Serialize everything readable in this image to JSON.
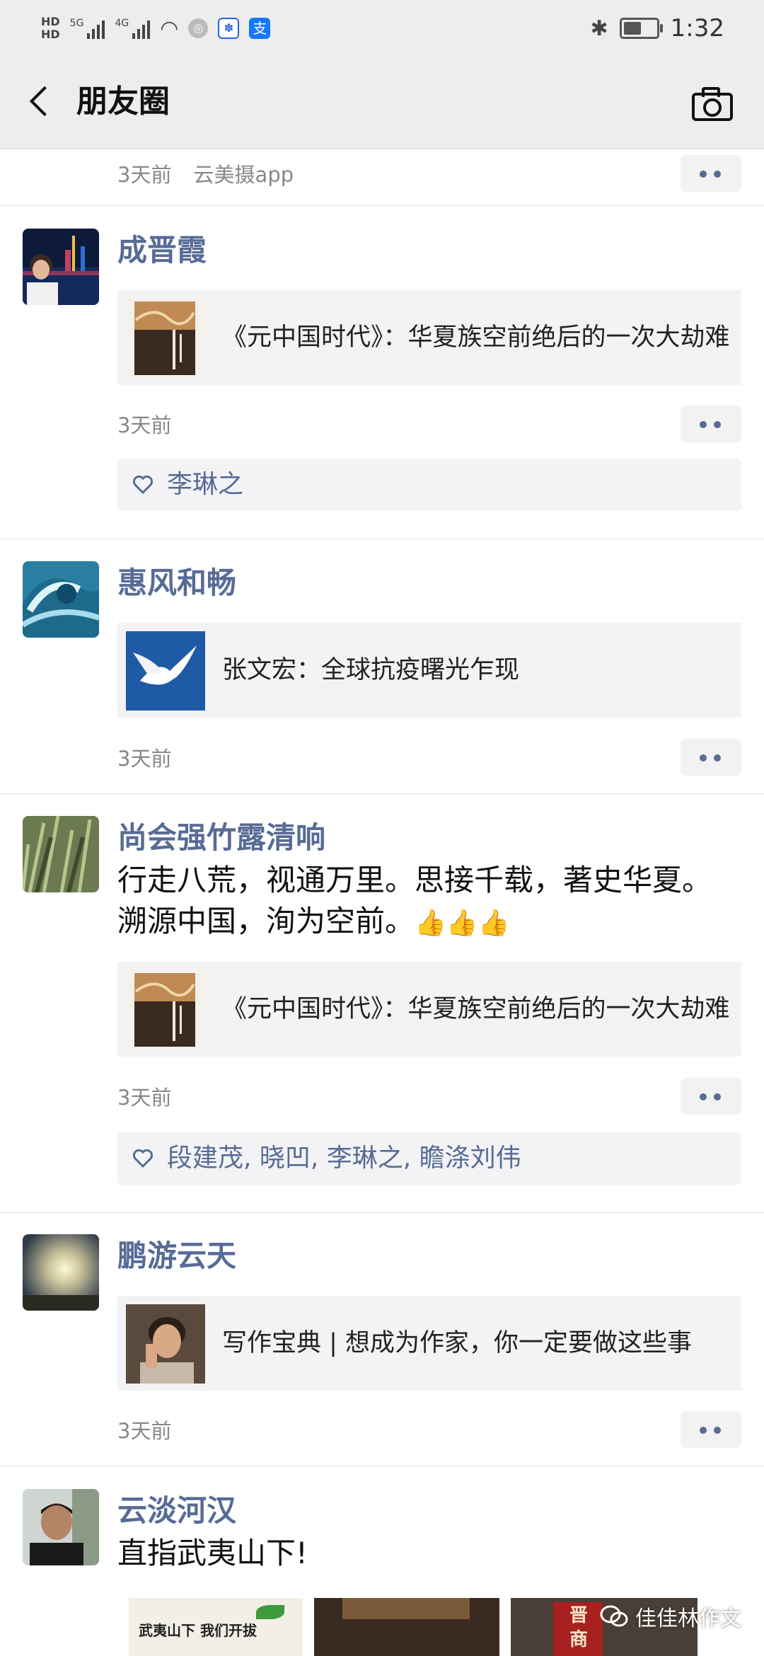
{
  "status_bar": {
    "hd1": "HD",
    "hd2": "HD",
    "net1": "5G",
    "net2": "4G",
    "time": "1:32",
    "battery_level": 0.55,
    "pay_icon": "支"
  },
  "nav": {
    "title": "朋友圈"
  },
  "top_partial": {
    "time": "3天前",
    "source": "云美摄app"
  },
  "posts": [
    {
      "name": "成晋霞",
      "link_title": "《元中国时代》：华夏族空前绝后的一次大劫难",
      "time": "3天前",
      "likes": "李琳之"
    },
    {
      "name": "惠风和畅",
      "link_title": "张文宏：全球抗疫曙光乍现",
      "time": "3天前"
    },
    {
      "name": "尚会强竹露清响",
      "text": "行走八荒，视通万里。思接千载，著史华夏。溯源中国，洵为空前。",
      "link_title": "《元中国时代》：华夏族空前绝后的一次大劫难",
      "time": "3天前",
      "likes": "段建茂, 晓凹, 李琳之, 瞻涤刘伟"
    },
    {
      "name": "鹏游云天",
      "link_title": "写作宝典 | 想成为作家，你一定要做这些事",
      "time": "3天前"
    },
    {
      "name": "云淡河汉",
      "text": "直指武夷山下!",
      "photo1_text": "武夷山下 我们开拔",
      "photo3_text": "晋 商"
    }
  ],
  "watermark": "佳佳林作文",
  "colors": {
    "name_blue": "#576b95",
    "bar_bg": "#ededed",
    "card_bg": "#f3f3f5"
  }
}
